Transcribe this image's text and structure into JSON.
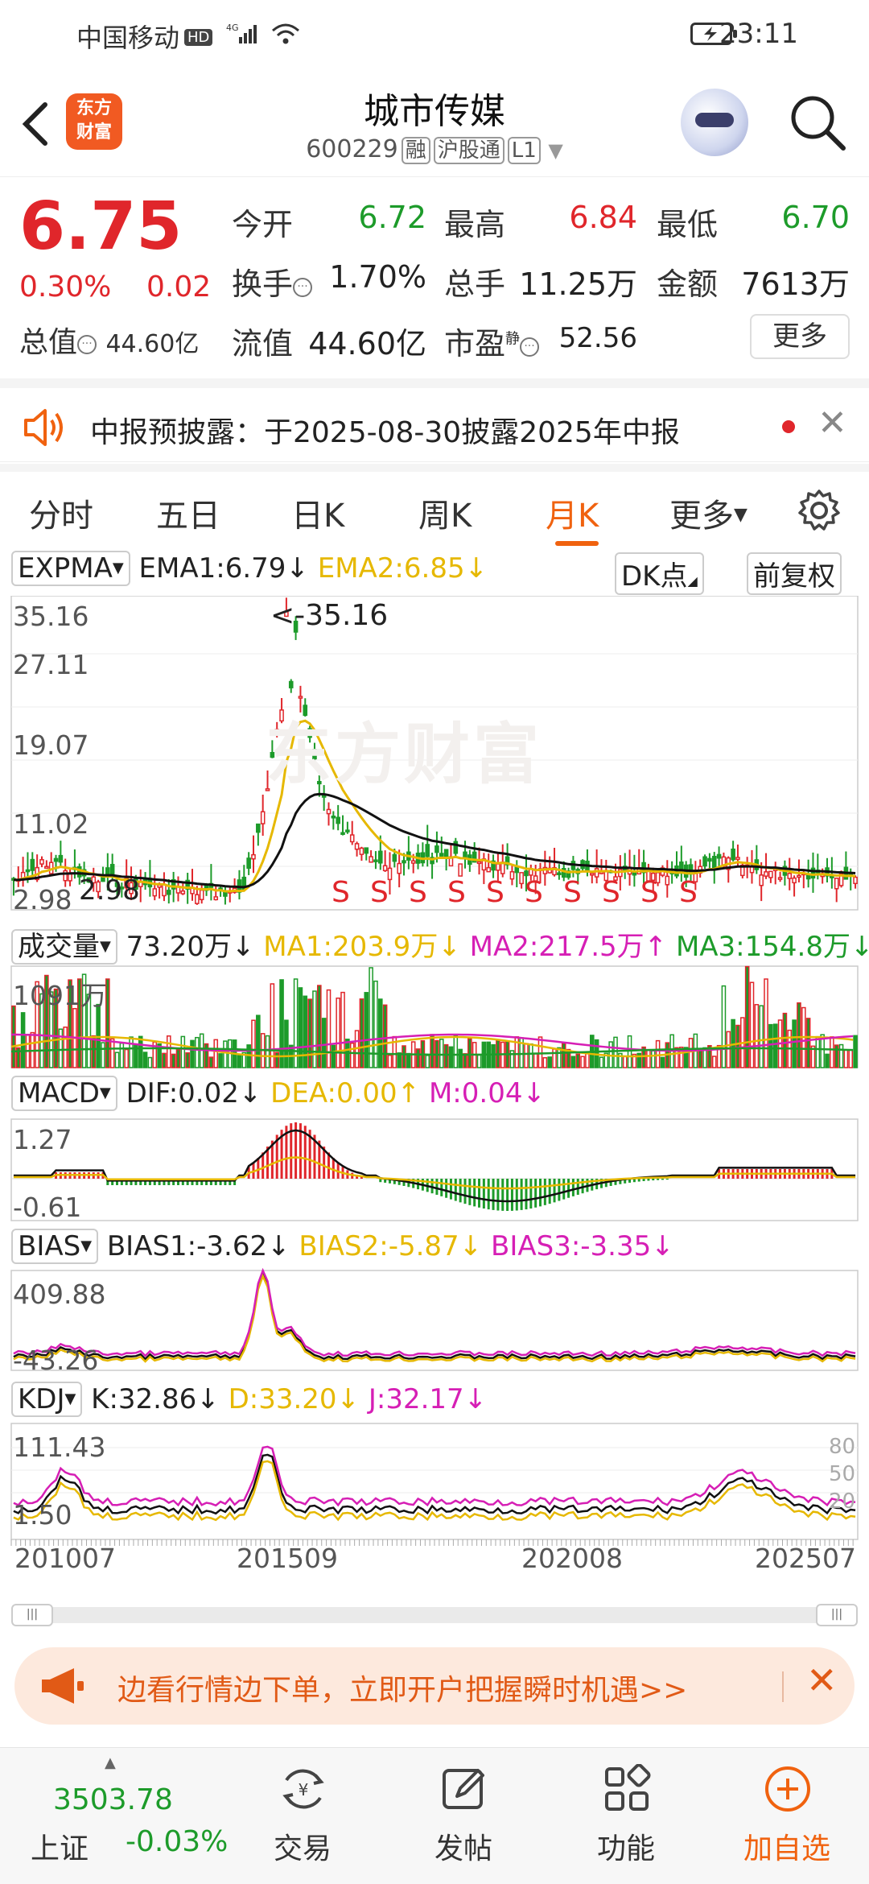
{
  "status_bar": {
    "carrier": "中国移动",
    "hd": "HD",
    "net": "4G",
    "time": "23:11"
  },
  "header": {
    "back_icon": "chevron-left-icon",
    "logo_text_1": "东方",
    "logo_text_2": "财富",
    "title": "城市传媒",
    "code": "600229",
    "tag_margin": "融",
    "tag_connect": "沪股通",
    "tag_level": "L1"
  },
  "quote": {
    "price": "6.75",
    "change_pct": "0.30%",
    "change": "0.02",
    "total_value_label": "总值",
    "total_value": "44.60亿",
    "open_label": "今开",
    "open": "6.72",
    "high_label": "最高",
    "high": "6.84",
    "low_label": "最低",
    "low": "6.70",
    "turnover_label": "换手",
    "turnover": "1.70%",
    "volume_label": "总手",
    "volume": "11.25万",
    "amount_label": "金额",
    "amount": "7613万",
    "float_label": "流值",
    "float_value": "44.60亿",
    "pe_label": "市盈",
    "pe_sup": "静",
    "pe": "52.56",
    "more_label": "更多"
  },
  "notice": {
    "text": "中报预披露：于2025-08-30披露2025年中报"
  },
  "tabs": [
    "分时",
    "五日",
    "日K",
    "周K",
    "月K",
    "更多"
  ],
  "active_tab": "月K",
  "indicators": {
    "main": {
      "name": "EXPMA",
      "ema1": "EMA1:6.79",
      "ema2": "EMA2:6.85",
      "dk": "DK点",
      "adj": "前复权",
      "y_labels": [
        "35.16",
        "27.11",
        "19.07",
        "11.02",
        "2.98"
      ],
      "peak_label": "<-35.16",
      "low_label": "2.98"
    },
    "volume": {
      "name": "成交量",
      "v": "73.20万",
      "ma1": "MA1:203.9万",
      "ma2": "MA2:217.5万",
      "ma3": "MA3:154.8万",
      "y_top": "1091万"
    },
    "macd": {
      "name": "MACD",
      "dif": "DIF:0.02",
      "dea": "DEA:0.00",
      "m": "M:0.04",
      "y_top": "1.27",
      "y_bottom": "-0.61"
    },
    "bias": {
      "name": "BIAS",
      "b1": "BIAS1:-3.62",
      "b2": "BIAS2:-5.87",
      "b3": "BIAS3:-3.35",
      "y_top": "409.88",
      "y_bottom": "-43.26"
    },
    "kdj": {
      "name": "KDJ",
      "k": "K:32.86",
      "d": "D:33.20",
      "j": "J:32.17",
      "y_top": "111.43",
      "y_bottom": "1.50",
      "r80": "80",
      "r50": "50",
      "r20": "20"
    },
    "x_labels": [
      "201007",
      "201509",
      "202008",
      "202507"
    ]
  },
  "watermark": "东方财富",
  "promo": {
    "text": "边看行情边下单，立即开户把握瞬时机遇>>"
  },
  "bottom_nav": {
    "index_value": "3503.78",
    "index_name": "上证",
    "index_change": "-0.03%",
    "items": [
      "交易",
      "发帖",
      "功能",
      "加自选"
    ]
  },
  "colors": {
    "up": "#e0262b",
    "down": "#1d9b2a",
    "accent": "#f0620f",
    "yellow": "#e6b800",
    "magenta": "#d61fb5"
  }
}
